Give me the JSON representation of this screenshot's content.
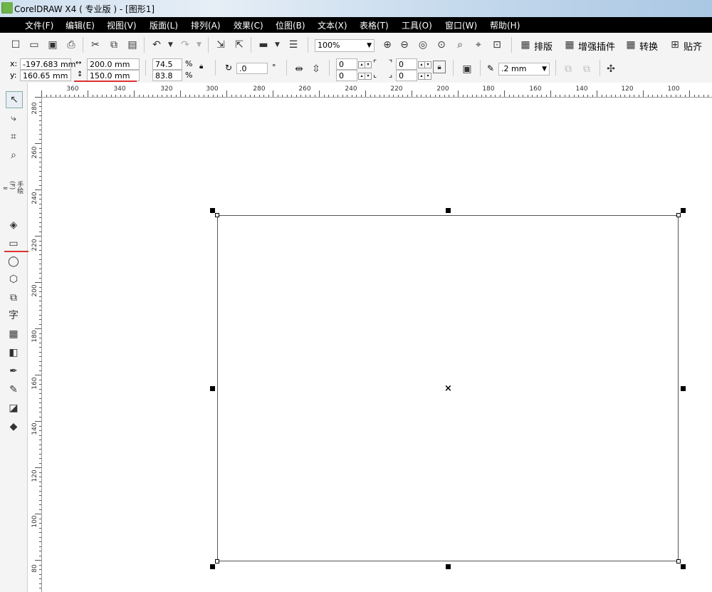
{
  "window": {
    "title": "CorelDRAW X4 ( 专业版 ) - [图形1]"
  },
  "menu": {
    "items": [
      "文件(F)",
      "编辑(E)",
      "视图(V)",
      "版面(L)",
      "排列(A)",
      "效果(C)",
      "位图(B)",
      "文本(X)",
      "表格(T)",
      "工具(O)",
      "窗口(W)",
      "帮助(H)"
    ]
  },
  "standard_toolbar": {
    "zoom_level": "100%",
    "plugins": [
      "排版",
      "增强插件",
      "转换",
      "贴齐"
    ]
  },
  "property_bar": {
    "x_label": "x:",
    "x_value": "-197.683 mm",
    "y_label": "y:",
    "y_value": "160.65 mm",
    "width_value": "200.0 mm",
    "height_value": "150.0 mm",
    "scale_x": "74.5",
    "scale_y": "83.8",
    "percent": "%",
    "rotation": ".0",
    "degree": "°",
    "corner_1": "0",
    "corner_2": "0",
    "corner_3": "0",
    "corner_4": "0",
    "outline_width": ".2 mm"
  },
  "hruler_labels": [
    "360",
    "340",
    "320",
    "300",
    "280",
    "260",
    "240",
    "220",
    "200",
    "180",
    "160",
    "140",
    "120",
    "100"
  ],
  "vruler_labels": [
    "280",
    "260",
    "240",
    "220",
    "200",
    "180",
    "160",
    "140",
    "120",
    "100",
    "80"
  ],
  "toolbox": {
    "freehand_label": "手绘(F)",
    "text_tool_glyph": "字"
  },
  "canvas": {
    "center_marker": "×"
  }
}
